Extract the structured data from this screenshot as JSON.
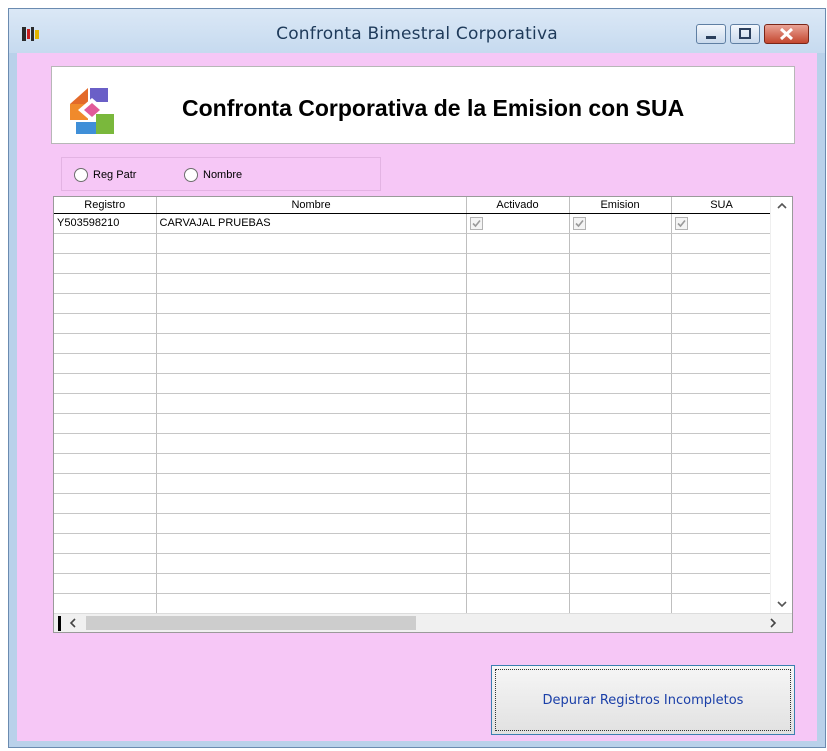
{
  "window": {
    "title": "Confronta Bimestral Corporativa",
    "controls": [
      "minimize-icon",
      "maximize-icon",
      "close-icon"
    ]
  },
  "banner": {
    "title": "Confronta Corporativa de la Emision con SUA",
    "logo_icon": "app-logo-icon"
  },
  "filters": {
    "options": [
      {
        "label": "Reg Patr",
        "selected": false
      },
      {
        "label": "Nombre",
        "selected": false
      }
    ]
  },
  "grid": {
    "columns": [
      "Registro",
      "Nombre",
      "Activado",
      "Emision",
      "SUA"
    ],
    "rows": [
      {
        "registro": "Y503598210",
        "nombre": "CARVAJAL PRUEBAS",
        "activado": true,
        "emision": true,
        "sua": true
      }
    ]
  },
  "actions": {
    "depurar_label": "Depurar Registros Incompletos"
  },
  "colors": {
    "client_background": "#f6c7f6",
    "button_text": "#1a3fa8",
    "close_button": "#c4472f"
  }
}
